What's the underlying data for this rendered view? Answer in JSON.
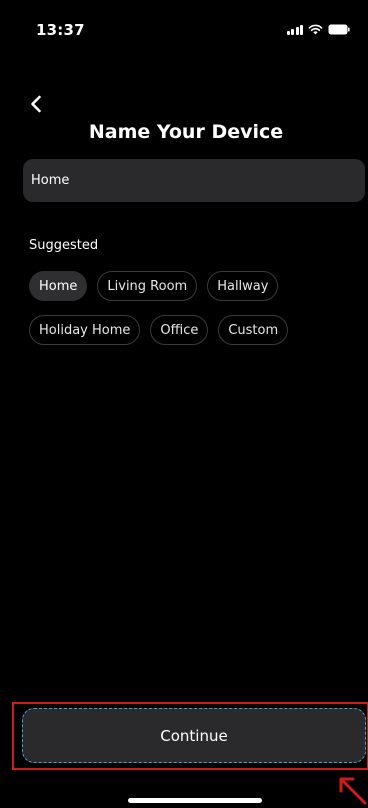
{
  "status_bar": {
    "time": "13:37",
    "icons": [
      "signal-icon",
      "wifi-icon",
      "battery-icon"
    ]
  },
  "header": {
    "back_icon": "chevron-left-icon",
    "title": "Name Your Device"
  },
  "name_input": {
    "value": "Home"
  },
  "suggested": {
    "label": "Suggested",
    "chips": [
      {
        "label": "Home",
        "selected": true
      },
      {
        "label": "Living Room",
        "selected": false
      },
      {
        "label": "Hallway",
        "selected": false
      },
      {
        "label": "Holiday Home",
        "selected": false
      },
      {
        "label": "Office",
        "selected": false
      },
      {
        "label": "Custom",
        "selected": false
      }
    ]
  },
  "footer": {
    "continue_label": "Continue",
    "highlight_color": "#d11a1a",
    "annotation_icon": "arrow-icon"
  },
  "colors": {
    "background": "#000000",
    "surface": "#2a2a2c",
    "chip_border": "#3b3b3d",
    "focus_dash": "#3aa7d8"
  }
}
